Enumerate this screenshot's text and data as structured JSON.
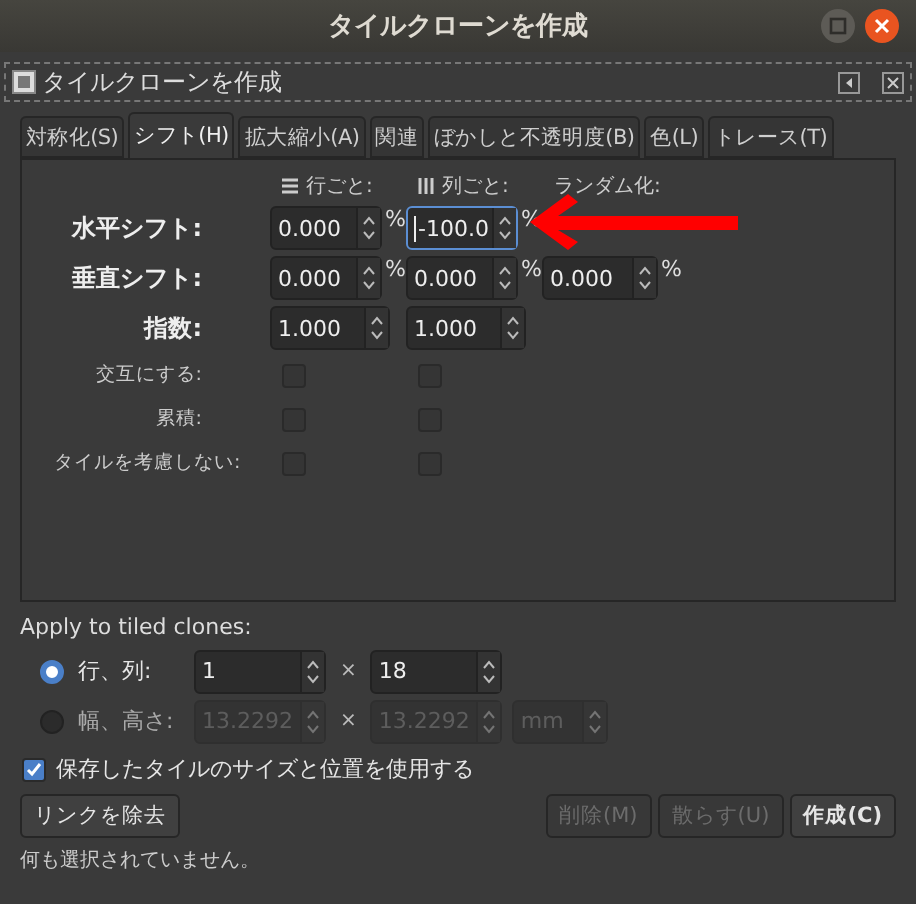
{
  "window": {
    "title": "タイルクローンを作成"
  },
  "panel": {
    "title": "タイルクローンを作成"
  },
  "tabs": [
    {
      "label": "対称化(S)",
      "selected": false
    },
    {
      "label": "シフト(H)",
      "selected": true
    },
    {
      "label": "拡大縮小(A)",
      "selected": false
    },
    {
      "label": "関連",
      "selected": false
    },
    {
      "label": "ぼかしと不透明度(B)",
      "selected": false
    },
    {
      "label": "色(L)",
      "selected": false
    },
    {
      "label": "トレース(T)",
      "selected": false
    }
  ],
  "shift_grid": {
    "columns": [
      {
        "label": "行ごと:",
        "kind": "rows"
      },
      {
        "label": "列ごと:",
        "kind": "columns"
      },
      {
        "label": "ランダム化:",
        "kind": "plain"
      }
    ],
    "rows": [
      {
        "kind": "spin",
        "label": "水平シフト:",
        "fields": [
          {
            "value": "0.000",
            "unit": "%",
            "focused": false
          },
          {
            "value": "-100.0",
            "unit": "%",
            "focused": true
          }
        ]
      },
      {
        "kind": "spin",
        "label": "垂直シフト:",
        "fields": [
          {
            "value": "0.000",
            "unit": "%",
            "focused": false
          },
          {
            "value": "0.000",
            "unit": "%",
            "focused": false
          },
          {
            "value": "0.000",
            "unit": "%",
            "focused": false
          }
        ]
      },
      {
        "kind": "spin",
        "label": "指数:",
        "fields": [
          {
            "value": "1.000",
            "focused": false
          },
          {
            "value": "1.000",
            "focused": false
          }
        ]
      },
      {
        "kind": "check",
        "label": "交互にする:",
        "checks": [
          false,
          false
        ]
      },
      {
        "kind": "check",
        "label": "累積:",
        "checks": [
          false,
          false
        ]
      },
      {
        "kind": "check",
        "label": "タイルを考慮しない:",
        "checks": [
          false,
          false
        ]
      }
    ]
  },
  "apply": {
    "label": "Apply to tiled clones:",
    "options": [
      {
        "label": "行、列:",
        "selected": true,
        "disabled": false,
        "fields": [
          "1",
          "18"
        ],
        "separator": "×"
      },
      {
        "label": "幅、高さ:",
        "selected": false,
        "disabled": true,
        "fields": [
          "13.2292",
          "13.2292"
        ],
        "separator": "×",
        "unit": "mm"
      }
    ]
  },
  "use_saved": {
    "label": "保存したタイルのサイズと位置を使用する",
    "checked": true
  },
  "buttons": [
    {
      "label": "リンクを除去",
      "disabled": false
    },
    {
      "label": "削除(M)",
      "disabled": true
    },
    {
      "label": "散らす(U)",
      "disabled": true
    },
    {
      "label": "作成(C)",
      "disabled": false
    }
  ],
  "status": "何も選択されていません。",
  "annotation": {
    "kind": "arrow"
  }
}
